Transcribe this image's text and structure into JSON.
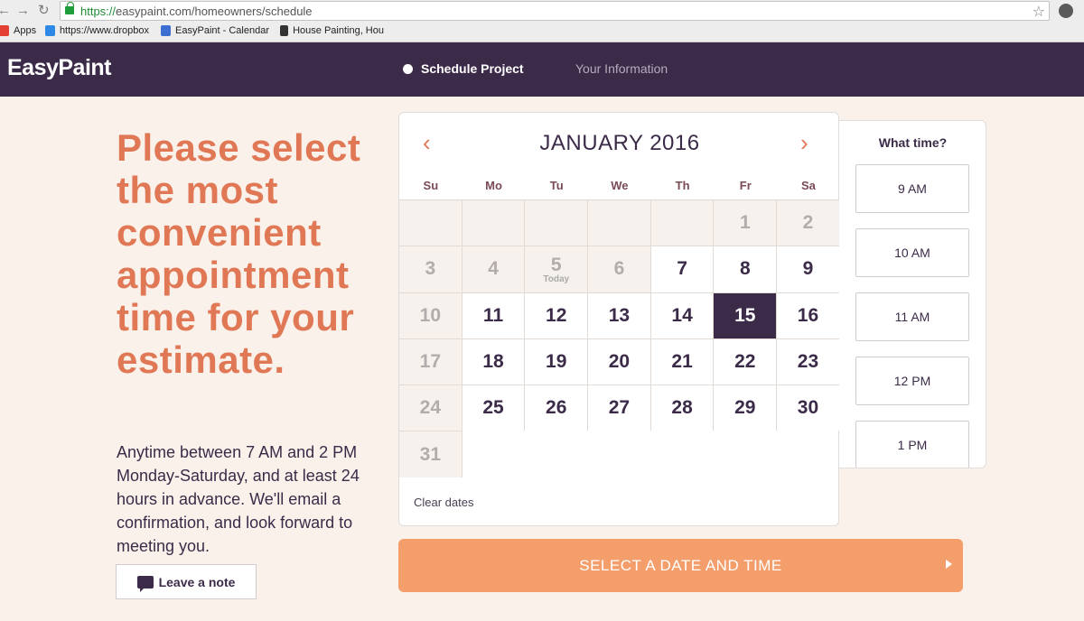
{
  "browser": {
    "url_scheme": "https://",
    "url_rest": "easypaint.com/homeowners/schedule",
    "bookmarks": [
      {
        "label": "Apps",
        "color": "#e34133"
      },
      {
        "label": "https://www.dropbox",
        "color": "#2d88e6"
      },
      {
        "label": "EasyPaint - Calendar",
        "color": "#3d6fd3"
      },
      {
        "label": "House Painting, Hou",
        "color": "#333333"
      }
    ]
  },
  "header": {
    "logo": "EasyPaint",
    "steps": [
      "Schedule Project",
      "Your Information"
    ],
    "active_step": 0
  },
  "intro": {
    "headline": "Please select the most convenient appointment time for your estimate.",
    "body": "Anytime between 7 AM and 2 PM Monday-Saturday, and at least 24 hours in advance. We'll email a confirmation, and look forward to meeting you.",
    "note_button": "Leave a note"
  },
  "calendar": {
    "title": "JANUARY 2016",
    "weekdays": [
      "Su",
      "Mo",
      "Tu",
      "We",
      "Th",
      "Fr",
      "Sa"
    ],
    "first_weekday_index": 5,
    "days_in_month": 31,
    "today": 5,
    "today_label": "Today",
    "selected": 15,
    "first_available": 7,
    "unavailable_weekday_index": 0,
    "clear_label": "Clear dates"
  },
  "time_picker": {
    "title": "What time?",
    "slots": [
      "9 AM",
      "10 AM",
      "11 AM",
      "12 PM",
      "1 PM"
    ]
  },
  "cta": {
    "label": "SELECT A DATE AND TIME"
  },
  "colors": {
    "brand_dark": "#3b2b48",
    "accent": "#e07856",
    "cta": "#f49e6c",
    "background": "#f9f1ea"
  }
}
